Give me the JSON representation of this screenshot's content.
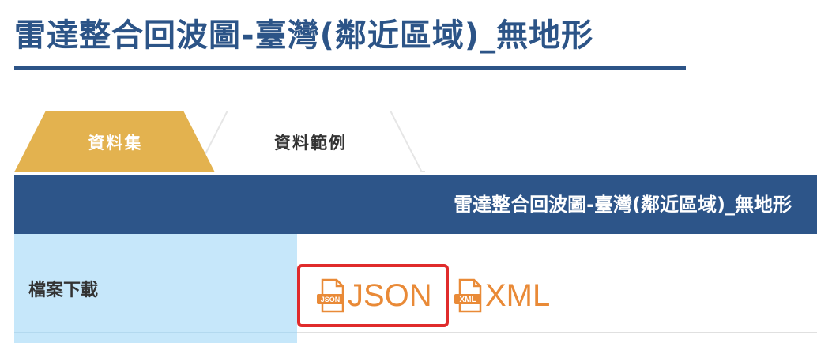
{
  "page": {
    "title": "雷達整合回波圖-臺灣(鄰近區域)_無地形"
  },
  "tabs": [
    {
      "label": "資料集",
      "active": true
    },
    {
      "label": "資料範例",
      "active": false
    }
  ],
  "table": {
    "header": "雷達整合回波圖-臺灣(鄰近區域)_無地形",
    "rows": [
      {
        "label": "檔案下載"
      }
    ]
  },
  "downloads": [
    {
      "label": "JSON",
      "icon": "json-file-icon",
      "icon_text": "JSON"
    },
    {
      "label": "XML",
      "icon": "xml-file-icon",
      "icon_text": "XML"
    }
  ],
  "colors": {
    "title": "#2c5487",
    "header_bg": "#2d5589",
    "label_bg": "#c6e7fa",
    "tab_active": "#e3b24f",
    "link": "#e98a37",
    "highlight": "#e02b2b"
  }
}
